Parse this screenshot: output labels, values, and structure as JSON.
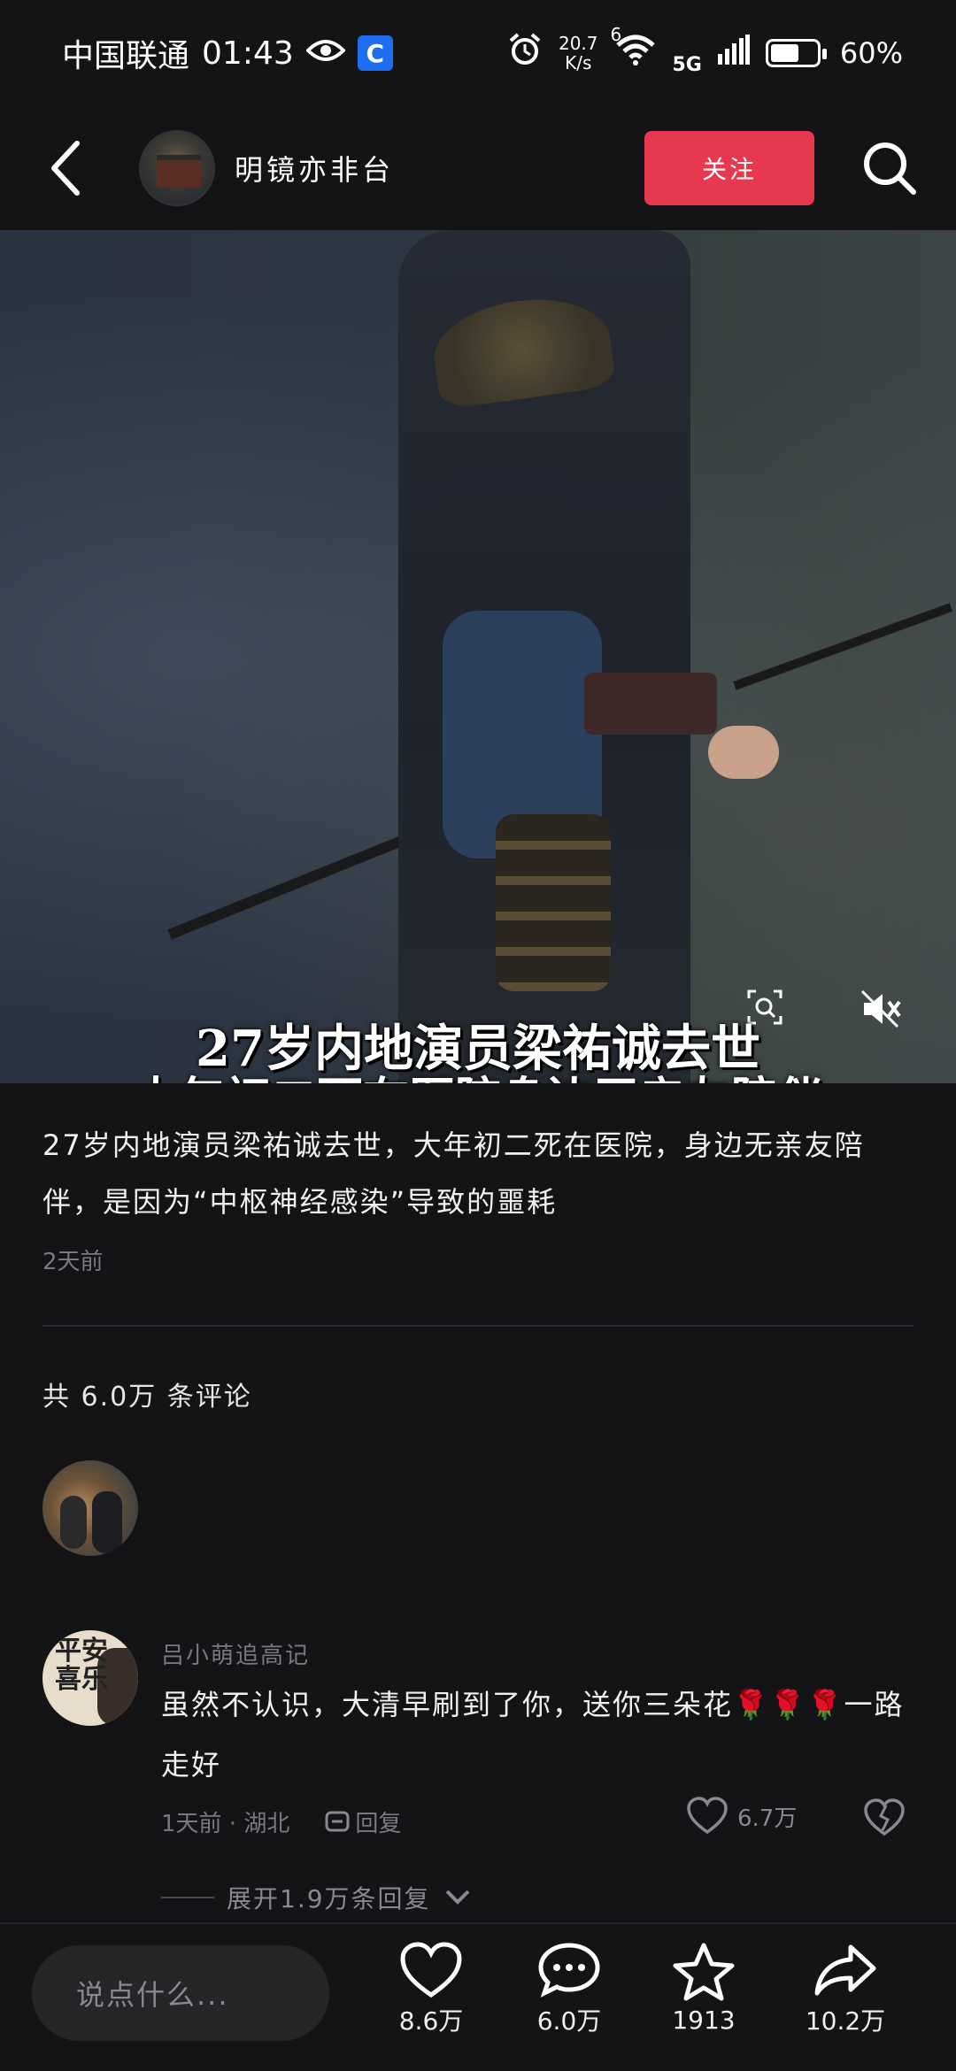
{
  "status_bar": {
    "carrier": "中国联通",
    "time": "01:43",
    "net_speed_value": "20.7",
    "net_speed_unit": "K/s",
    "wifi_label": "6",
    "network": "5G",
    "battery_percent": "60%",
    "battery_level": 0.6
  },
  "nav": {
    "channel_name": "明镜亦非台",
    "follow_label": "关注"
  },
  "video": {
    "caption_line1": "27岁内地演员梁祐诚去世",
    "caption_line2": "大年初二死在医院身边无亲友陪伴"
  },
  "post": {
    "title": "27岁内地演员梁祐诚去世，大年初二死在医院，身边无亲友陪伴，是因为“中枢神经感染”导致的噩耗",
    "time": "2天前",
    "comment_count": "共 6.0万 条评论"
  },
  "comment": {
    "avatar_text": "平安喜乐",
    "user": "吕小萌追高记",
    "text": "虽然不认识，大清早刷到了你，送你三朵花🌹🌹🌹一路走好",
    "time_location": "1天前 · 湖北",
    "reply_label": "回复",
    "likes": "6.7万",
    "expand_label": "展开1.9万条回复"
  },
  "bottom_bar": {
    "input_placeholder": "说点什么...",
    "likes": "8.6万",
    "comments": "6.0万",
    "favorites": "1913",
    "shares": "10.2万"
  },
  "icons": [
    "back-arrow-icon",
    "search-icon",
    "camera-lens-icon",
    "mute-icon",
    "heart-icon",
    "comment-icon",
    "star-icon",
    "share-icon",
    "reply-icon",
    "dislike-icon",
    "chevron-down-icon",
    "alarm-icon",
    "wifi-icon",
    "signal-icon",
    "eye-icon"
  ],
  "colors": {
    "accent": "#e8384f",
    "background": "#141416",
    "muted_text": "#7a7a7e"
  }
}
